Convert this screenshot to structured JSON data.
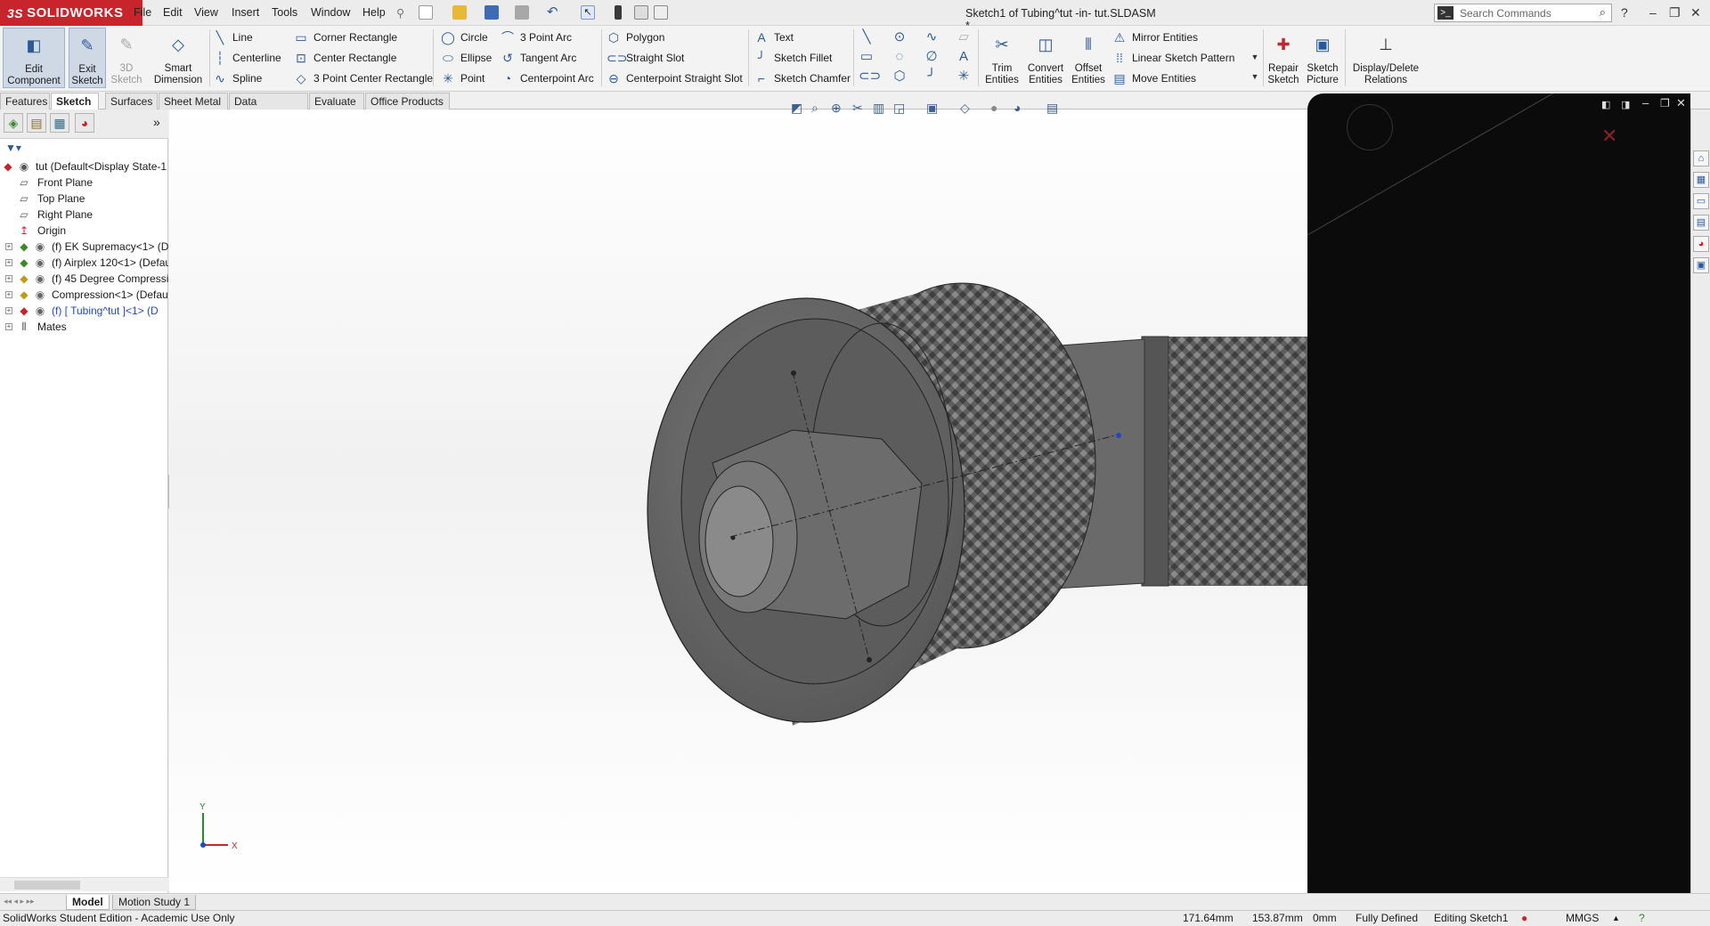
{
  "app": {
    "brand": "SOLIDWORKS"
  },
  "menu": [
    "File",
    "Edit",
    "View",
    "Insert",
    "Tools",
    "Window",
    "Help"
  ],
  "document_title": "Sketch1 of Tubing^tut -in- tut.SLDASM *",
  "search": {
    "placeholder": "Search Commands"
  },
  "command_manager": {
    "edit_component": "Edit\nComponent",
    "exit_sketch": "Exit\nSketch",
    "sketch_3d": "3D\nSketch",
    "smart_dimension": "Smart\nDimension",
    "line_tools": [
      "Line",
      "Centerline",
      "Spline"
    ],
    "rect_tools": [
      "Corner Rectangle",
      "Center Rectangle",
      "3 Point Center Rectangle"
    ],
    "curve_tools": [
      "Circle",
      "Ellipse",
      "Point"
    ],
    "arc_tools": [
      "3 Point Arc",
      "Tangent Arc",
      "Centerpoint Arc"
    ],
    "slot_tools": [
      "Polygon",
      "Straight Slot",
      "Centerpoint Straight Slot"
    ],
    "text_tools": [
      "Text",
      "Sketch Fillet",
      "Sketch Chamfer"
    ],
    "trim": "Trim\nEntities",
    "convert": "Convert\nEntities",
    "offset": "Offset\nEntities",
    "pattern_tools": [
      "Mirror Entities",
      "Linear Sketch Pattern",
      "Move Entities"
    ],
    "repair": "Repair\nSketch",
    "picture": "Sketch\nPicture",
    "relations": "Display/Delete\nRelations"
  },
  "tabs": [
    "Features",
    "Sketch",
    "Surfaces",
    "Sheet Metal",
    "Data Migration",
    "Evaluate",
    "Office Products"
  ],
  "active_tab": "Sketch",
  "feature_tree": [
    {
      "label": "tut  (Default<Display State-1",
      "icon": "assembly-icon"
    },
    {
      "label": "Front Plane",
      "icon": "plane-icon"
    },
    {
      "label": "Top Plane",
      "icon": "plane-icon"
    },
    {
      "label": "Right Plane",
      "icon": "plane-icon"
    },
    {
      "label": "Origin",
      "icon": "origin-icon"
    },
    {
      "label": "(f) EK Supremacy<1> (D",
      "icon": "subassembly-icon"
    },
    {
      "label": "(f) Airplex 120<1> (Defau",
      "icon": "subassembly-icon"
    },
    {
      "label": "(f) 45 Degree Compressi",
      "icon": "subassembly-icon"
    },
    {
      "label": "Compression<1> (Defau",
      "icon": "part-icon"
    },
    {
      "label": "(f) [ Tubing^tut ]<1> (D",
      "icon": "part-icon"
    },
    {
      "label": "Mates",
      "icon": "mates-icon"
    }
  ],
  "bottom_tabs": [
    "Model",
    "Motion Study 1"
  ],
  "status": {
    "edition": "SolidWorks Student Edition - Academic Use Only",
    "x": "171.64mm",
    "y": "153.87mm",
    "z": "0mm",
    "definition": "Fully Defined",
    "mode": "Editing Sketch1",
    "units": "MMGS"
  },
  "triad": {
    "y": "Y",
    "x": "X"
  },
  "colors": {
    "brand": "#c7242b",
    "accent": "#2b5a9b",
    "model": "#6e6e6e",
    "panel": "#0b0b0b"
  }
}
